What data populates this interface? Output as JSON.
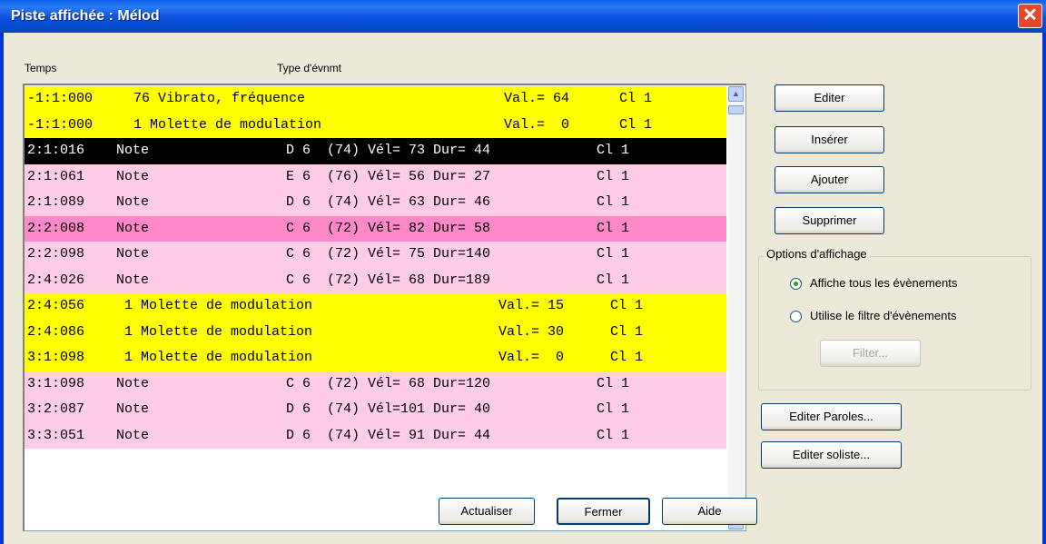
{
  "window": {
    "title": "Piste affichée : Mélod",
    "close_glyph": "✕"
  },
  "list_headers": {
    "time": "Temps",
    "type": "Type d'évnmt"
  },
  "rows": [
    {
      "bg": "#ffff00",
      "fg": "#000000",
      "time": "-1:1:000",
      "desc": "76 Vibrato, fréquence",
      "detail": "",
      "value": "Val.= 64",
      "channel": "Cl 1"
    },
    {
      "bg": "#ffff00",
      "fg": "#000000",
      "time": "-1:1:000",
      "desc": "1 Molette de modulation",
      "detail": "",
      "value": "Val.=  0",
      "channel": "Cl 1"
    },
    {
      "bg": "#000000",
      "fg": "#ffffff",
      "time": "2:1:016",
      "desc": "Note",
      "detail": "D 6  (74) Vél= 73 Dur= 44",
      "value": "",
      "channel": "Cl 1"
    },
    {
      "bg": "#ffcce6",
      "fg": "#000000",
      "time": "2:1:061",
      "desc": "Note",
      "detail": "E 6  (76) Vél= 56 Dur= 27",
      "value": "",
      "channel": "Cl 1"
    },
    {
      "bg": "#ffcce6",
      "fg": "#000000",
      "time": "2:1:089",
      "desc": "Note",
      "detail": "D 6  (74) Vél= 63 Dur= 46",
      "value": "",
      "channel": "Cl 1"
    },
    {
      "bg": "#ff88c8",
      "fg": "#000000",
      "time": "2:2:008",
      "desc": "Note",
      "detail": "C 6  (72) Vél= 82 Dur= 58",
      "value": "",
      "channel": "Cl 1"
    },
    {
      "bg": "#ffcce6",
      "fg": "#000000",
      "time": "2:2:098",
      "desc": "Note",
      "detail": "C 6  (72) Vél= 75 Dur=140",
      "value": "",
      "channel": "Cl 1"
    },
    {
      "bg": "#ffcce6",
      "fg": "#000000",
      "time": "2:4:026",
      "desc": "Note",
      "detail": "C 6  (72) Vél= 68 Dur=189",
      "value": "",
      "channel": "Cl 1"
    },
    {
      "bg": "#ffff00",
      "fg": "#000000",
      "time": "2:4:056",
      "desc": "1 Molette de modulation",
      "detail": "",
      "value": "Val.= 15",
      "channel": "Cl 1"
    },
    {
      "bg": "#ffff00",
      "fg": "#000000",
      "time": "2:4:086",
      "desc": "1 Molette de modulation",
      "detail": "",
      "value": "Val.= 30",
      "channel": "Cl 1"
    },
    {
      "bg": "#ffff00",
      "fg": "#000000",
      "time": "3:1:098",
      "desc": "1 Molette de modulation",
      "detail": "",
      "value": "Val.=  0",
      "channel": "Cl 1"
    },
    {
      "bg": "#ffcce6",
      "fg": "#000000",
      "time": "3:1:098",
      "desc": "Note",
      "detail": "C 6  (72) Vél= 68 Dur=120",
      "value": "",
      "channel": "Cl 1"
    },
    {
      "bg": "#ffcce6",
      "fg": "#000000",
      "time": "3:2:087",
      "desc": "Note",
      "detail": "D 6  (74) Vél=101 Dur= 40",
      "value": "",
      "channel": "Cl 1"
    },
    {
      "bg": "#ffcce6",
      "fg": "#000000",
      "time": "3:3:051",
      "desc": "Note",
      "detail": "D 6  (74) Vél= 91 Dur= 44",
      "value": "",
      "channel": "Cl 1"
    }
  ],
  "buttons": {
    "edit": "Editer",
    "insert": "Insérer",
    "add": "Ajouter",
    "delete": "Supprimer",
    "filter": "Filter...",
    "edit_lyrics": "Editer Paroles...",
    "edit_soloist": "Editer soliste...",
    "refresh": "Actualiser",
    "close": "Fermer",
    "help": "Aide"
  },
  "display_options": {
    "title": "Options d'affichage",
    "show_all": "Affiche tous les évènements",
    "use_filter": "Utilise le filtre d'évènements",
    "selected": "show_all"
  },
  "colors": {
    "event_yellow": "#ffff00",
    "note_pink": "#ffcce6",
    "note_highlight": "#ff88c8",
    "selected": "#000000"
  },
  "icons": {
    "scroll_up": "▲",
    "scroll_down": "▼"
  }
}
